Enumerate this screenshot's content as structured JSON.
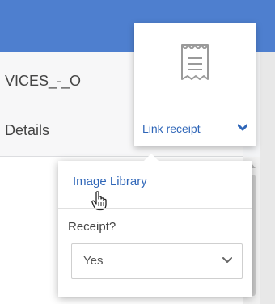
{
  "header": {
    "subtitle_fragment": "VICES_-_O",
    "tab_fragment": "Details"
  },
  "receipt_card": {
    "icon": "receipt-icon",
    "label": "Link receipt",
    "chevron_icon": "chevron-down-icon"
  },
  "dropdown": {
    "menu_item": "Image Library",
    "field_label": "Receipt?",
    "select_value": "Yes",
    "select_icon": "chevron-down-icon"
  },
  "colors": {
    "topbar": "#4e7fcf",
    "link": "#2f66b8"
  }
}
